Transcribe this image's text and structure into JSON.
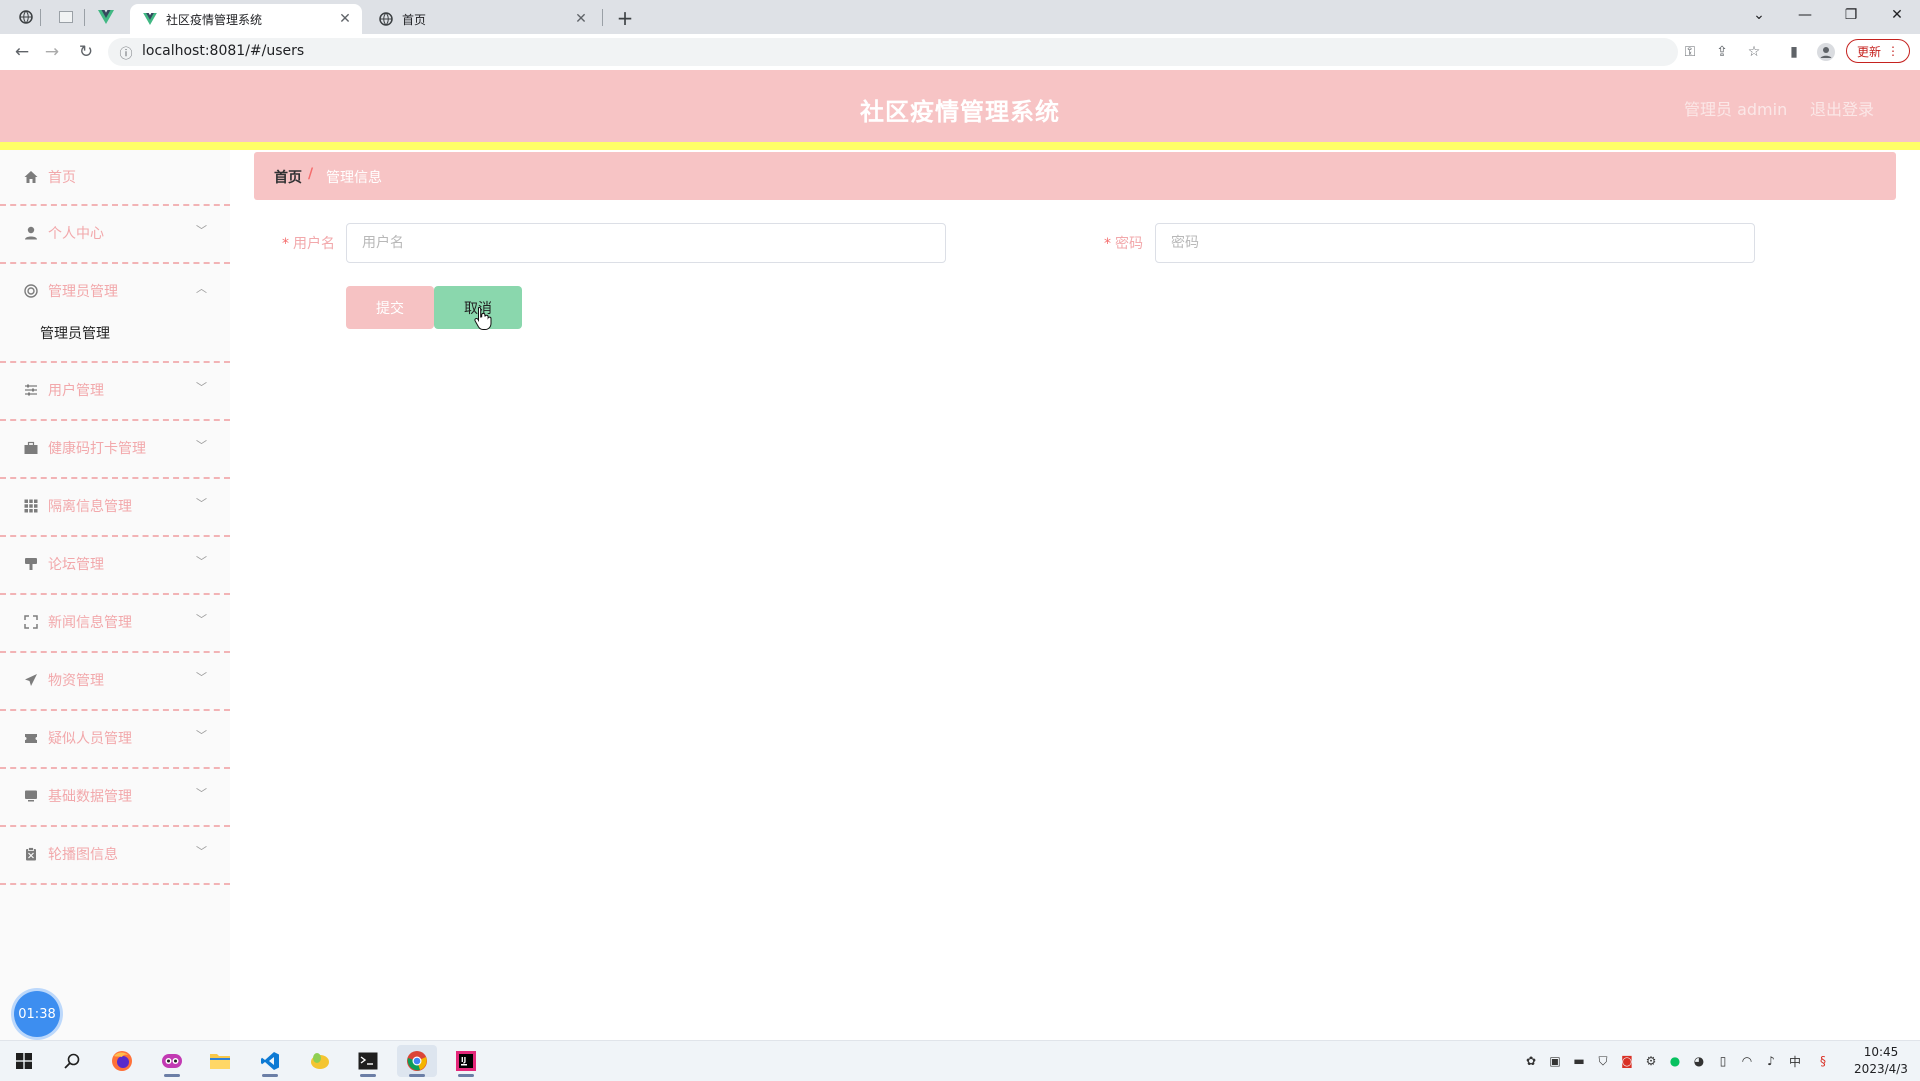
{
  "browser": {
    "tabs": [
      {
        "title": "社区疫情管理系统",
        "active": true
      },
      {
        "title": "首页",
        "active": false
      }
    ],
    "url": "localhost:8081/#/users",
    "update_label": "更新"
  },
  "header": {
    "title": "社区疫情管理系统",
    "user_label": "管理员 admin",
    "logout_label": "退出登录"
  },
  "sidebar": {
    "items": [
      {
        "label": "首页",
        "icon": "home-icon",
        "expandable": false
      },
      {
        "label": "个人中心",
        "icon": "user-icon",
        "expandable": true
      },
      {
        "label": "管理员管理",
        "icon": "target-icon",
        "expandable": true,
        "expanded": true
      },
      {
        "label": "用户管理",
        "icon": "sliders-icon",
        "expandable": true
      },
      {
        "label": "健康码打卡管理",
        "icon": "briefcase-icon",
        "expandable": true
      },
      {
        "label": "隔离信息管理",
        "icon": "grid-icon",
        "expandable": true
      },
      {
        "label": "论坛管理",
        "icon": "brush-icon",
        "expandable": true
      },
      {
        "label": "新闻信息管理",
        "icon": "fullscreen-icon",
        "expandable": true
      },
      {
        "label": "物资管理",
        "icon": "send-icon",
        "expandable": true
      },
      {
        "label": "疑似人员管理",
        "icon": "ticket-icon",
        "expandable": true
      },
      {
        "label": "基础数据管理",
        "icon": "monitor-icon",
        "expandable": true
      },
      {
        "label": "轮播图信息",
        "icon": "clipboard-icon",
        "expandable": true
      }
    ],
    "submenu_label": "管理员管理"
  },
  "breadcrumb": {
    "home": "首页",
    "separator": "/",
    "current": "管理信息"
  },
  "form": {
    "username": {
      "label": "用户名",
      "placeholder": "用户名",
      "value": ""
    },
    "password": {
      "label": "密码",
      "placeholder": "密码",
      "value": ""
    },
    "submit_label": "提交",
    "cancel_label": "取消"
  },
  "timer": "01:38",
  "clock": {
    "time": "10:45",
    "date": "2023/4/3"
  },
  "tray_lang": "中",
  "colors": {
    "header_bg": "#f7c4c5",
    "accent_yellow": "#ffff66",
    "menu_text": "#f2a8ab",
    "submit_bg": "#f6c2c3",
    "cancel_bg": "#8ad7ad"
  }
}
